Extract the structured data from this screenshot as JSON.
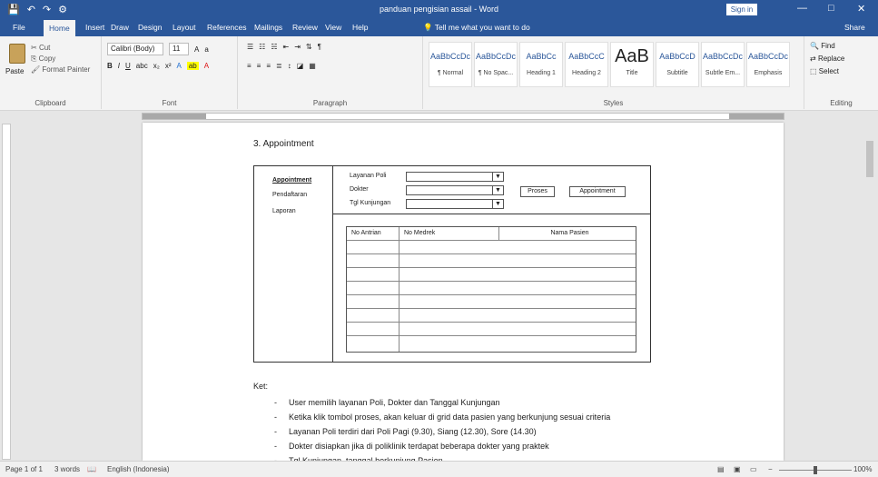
{
  "titlebar": {
    "title": "panduan pengisian assail - Word",
    "qat": [
      "💾",
      "↶",
      "↷",
      "⚙"
    ],
    "sign_in": "Sign in",
    "minimize": "—",
    "maximize": "□",
    "close": "✕"
  },
  "tabs": [
    "File",
    "Home",
    "Insert",
    "Draw",
    "Design",
    "Layout",
    "References",
    "Mailings",
    "Review",
    "View",
    "Help"
  ],
  "tell_me": "Tell me what you want to do",
  "share": "Share",
  "ribbon": {
    "clipboard": {
      "paste": "Paste",
      "cut": "Cut",
      "copy": "Copy",
      "format_painter": "Format Painter",
      "label": "Clipboard"
    },
    "font": {
      "family": "Calibri (Body)",
      "size": "11",
      "label": "Font"
    },
    "paragraph": {
      "label": "Paragraph"
    },
    "styles": {
      "label": "Styles",
      "items": [
        {
          "sample": "AaBbCcDc",
          "name": "¶ Normal"
        },
        {
          "sample": "AaBbCcDc",
          "name": "¶ No Spac..."
        },
        {
          "sample": "AaBbCc",
          "name": "Heading 1"
        },
        {
          "sample": "AaBbCcC",
          "name": "Heading 2"
        },
        {
          "sample": "AaB",
          "name": "Title"
        },
        {
          "sample": "AaBbCcD",
          "name": "Subtitle"
        },
        {
          "sample": "AaBbCcDc",
          "name": "Subtle Em..."
        },
        {
          "sample": "AaBbCcDc",
          "name": "Emphasis"
        }
      ]
    },
    "editing": {
      "find": "Find",
      "replace": "Replace",
      "select": "Select",
      "label": "Editing"
    }
  },
  "document": {
    "heading": "3.   Appointment",
    "mock": {
      "sidebar": [
        "Appointment",
        "Pendaftaran",
        "Laporan"
      ],
      "fields": [
        "Layanan Poli",
        "Dokter",
        "Tgl Kunjungan"
      ],
      "btn_proses": "Proses",
      "btn_appointment": "Appointment",
      "grid_headers": [
        "No Antrian",
        "No Medrek",
        "Nama Pasien"
      ]
    },
    "notes_title": "Ket:",
    "notes": [
      "User memilih layanan Poli, Dokter dan Tanggal Kunjungan",
      "Ketika klik tombol proses, akan keluar di grid data pasien yang berkunjung sesuai criteria",
      "Layanan Poli terdiri dari Poli Pagi (9.30), Siang (12.30), Sore (14.30)",
      "Dokter disiapkan jika di poliklinik terdapat beberapa dokter yang praktek",
      "Tgl Kunjungan, tanggal berkunjung Pasien"
    ]
  },
  "statusbar": {
    "page": "Page 1 of 1",
    "words": "3 words",
    "language": "English (Indonesia)",
    "zoom": "100%"
  }
}
